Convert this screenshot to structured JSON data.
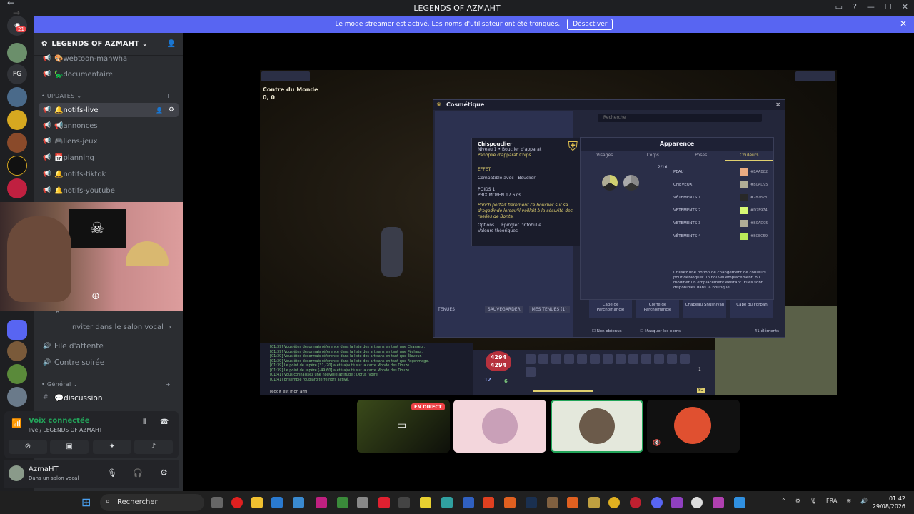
{
  "window": {
    "title": "LEGENDS OF AZMAHT",
    "back": "←",
    "forward": "→"
  },
  "banner": {
    "text": "Le mode streamer est activé. Les noms d'utilisateur ont été tronqués.",
    "button": "Désactiver",
    "close": "✕"
  },
  "rail": {
    "badge": "21",
    "fg": "FG"
  },
  "server": {
    "name": "LEGENDS OF AZMAHT",
    "chevron": "⌄"
  },
  "channels": {
    "top": [
      {
        "label": "🎨webtoon-manwha"
      },
      {
        "label": "🦕documentaire"
      }
    ],
    "updates_category": "UPDATES",
    "updates": [
      {
        "label": "🔔notifs-live",
        "active": true
      },
      {
        "label": "📢annonces"
      },
      {
        "label": "🎮liens-jeux"
      },
      {
        "label": "📅planning"
      },
      {
        "label": "🔔notifs-tiktok"
      },
      {
        "label": "🔔notifs-youtube"
      }
    ],
    "voice_user": "R...",
    "invite": "Inviter dans le salon vocal",
    "waiting": "File d'attente",
    "contre": "Contre soirée",
    "general_category": "Général",
    "discussion": "💬discussion"
  },
  "voice": {
    "status": "Voix connectée",
    "channel": "live / LEGENDS OF AZMAHT"
  },
  "user": {
    "name": "AzmaHT",
    "status": "Dans un salon vocal"
  },
  "game": {
    "location": "Contre du Monde",
    "coords": "0, 0",
    "cosmetic_title": "Cosmétique",
    "search_placeholder": "Recherche",
    "tenues": "TENUES",
    "save_btn": "SAUVEGARDER",
    "my_outfits": "MES TENUES (1)",
    "items": [
      "Cape de Parchomancie",
      "Coiffe de Parchomancie",
      "Chapeau Shushivan",
      "Cape du Forban"
    ],
    "not_owned": "Non obtenus",
    "hide_names": "Masquer les noms",
    "elements": "41 éléments"
  },
  "tooltip": {
    "name": "Chispouclier",
    "level": "Niveau 1 • Bouclier d'apparat",
    "set": "Panoplie d'apparat Chips",
    "effect_title": "EFFET",
    "compat": "Compatible avec : Bouclier",
    "weight": "POIDS 1",
    "price": "PRIX MOYEN 17 673",
    "desc": "Ponch portait fièrement ce bouclier sur sa dragodinde lorsqu'il veillait à la sécurité des ruelles de Bonta.",
    "options": "Options",
    "pin": "Épingler l'infobulle",
    "theory": "Valeurs théoriques"
  },
  "appearance": {
    "title": "Apparence",
    "tabs": [
      "Visages",
      "Corps",
      "Poses",
      "Couleurs"
    ],
    "count": "2/16",
    "colors": [
      {
        "label": "PEAU",
        "hex": "#EAAB82",
        "color": "#EAAB82"
      },
      {
        "label": "CHEVEUX",
        "hex": "#B0AD95",
        "color": "#B0AD95"
      },
      {
        "label": "VÊTEMENTS 1",
        "hex": "#282828",
        "color": "#282828"
      },
      {
        "label": "VÊTEMENTS 2",
        "hex": "#D7F974",
        "color": "#D7F974"
      },
      {
        "label": "VÊTEMENTS 3",
        "hex": "#B0AD95",
        "color": "#B0AD95"
      },
      {
        "label": "VÊTEMENTS 4",
        "hex": "#BCEC59",
        "color": "#BCEC59"
      }
    ],
    "info": "Utilisez une potion de changement de couleurs pour débloquer un nouvel emplacement, ou modifier un emplacement existant. Elles sont disponibles dans la boutique."
  },
  "chat": {
    "lines": [
      "[01:39] Vous êtes désormais référencé dans la liste des artisans en tant que Chasseur.",
      "[01:39] Vous êtes désormais référencé dans la liste des artisans en tant que Pêcheur.",
      "[01:39] Vous êtes désormais référencé dans la liste des artisans en tant que Éleveur.",
      "[01:39] Vous êtes désormais référencé dans la liste des artisans en tant que Façonmage.",
      "[01:39] Le point de repère [31,-20] a été ajouté sur la carte Monde des Douze.",
      "[01:39] Le point de repère [-49,60] a été ajouté sur la carte Monde des Douze.",
      "[01:41] Vous connaissez une nouvelle attitude : Dofus Ivoire",
      "[01:41] Ensemble roublard terre hors activé."
    ],
    "input": "reddit est mon ami"
  },
  "hud": {
    "hp": "4294",
    "hp_max": "4294",
    "ap": "12",
    "mp": "6",
    "page": "1",
    "level_badge": "82"
  },
  "stream": {
    "live_badge": "EN DIRECT"
  },
  "taskbar": {
    "search": "Rechercher",
    "lang": "FRA",
    "time": "01:42",
    "date": "29/08/2026"
  }
}
